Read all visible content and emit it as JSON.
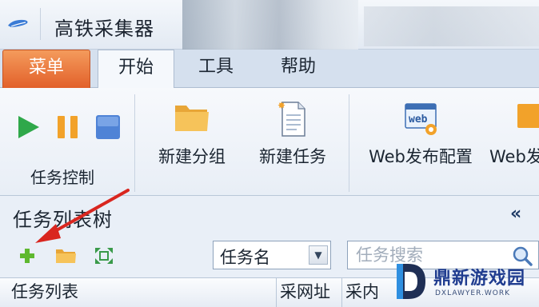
{
  "window": {
    "title": "高铁采集器"
  },
  "tabs": [
    {
      "label": "菜单",
      "active": false
    },
    {
      "label": "开始",
      "active": true
    },
    {
      "label": "工具",
      "active": false
    },
    {
      "label": "帮助",
      "active": false
    }
  ],
  "ribbon": {
    "task_control": {
      "label": "任务控制",
      "icons": [
        "play-icon",
        "pause-icon",
        "stop-icon"
      ]
    },
    "buttons": [
      {
        "label": "新建分组",
        "icon": "folder-icon"
      },
      {
        "label": "新建任务",
        "icon": "new-document-icon"
      },
      {
        "label": "Web发布配置",
        "icon": "web-config-icon"
      },
      {
        "label": "Web发",
        "icon": "web-config-icon"
      }
    ]
  },
  "tree_panel": {
    "title": "任务列表树",
    "collapse_glyph": "«",
    "toolbar_icons": [
      "add-icon",
      "folder-icon",
      "expand-icon"
    ],
    "filter_select": {
      "value": "任务名"
    },
    "search": {
      "placeholder": "任务搜索"
    },
    "columns": [
      "任务列表",
      "采网址",
      "采内"
    ]
  },
  "watermark": {
    "text": "鼎新游戏园",
    "sub": "DXLAWYER.WORK"
  },
  "colors": {
    "menu_tab": "#e2602a",
    "play_green": "#2fa84a",
    "pause_orange": "#f2a22a",
    "stop_blue": "#4f83d6",
    "arrow_red": "#d9261f"
  }
}
